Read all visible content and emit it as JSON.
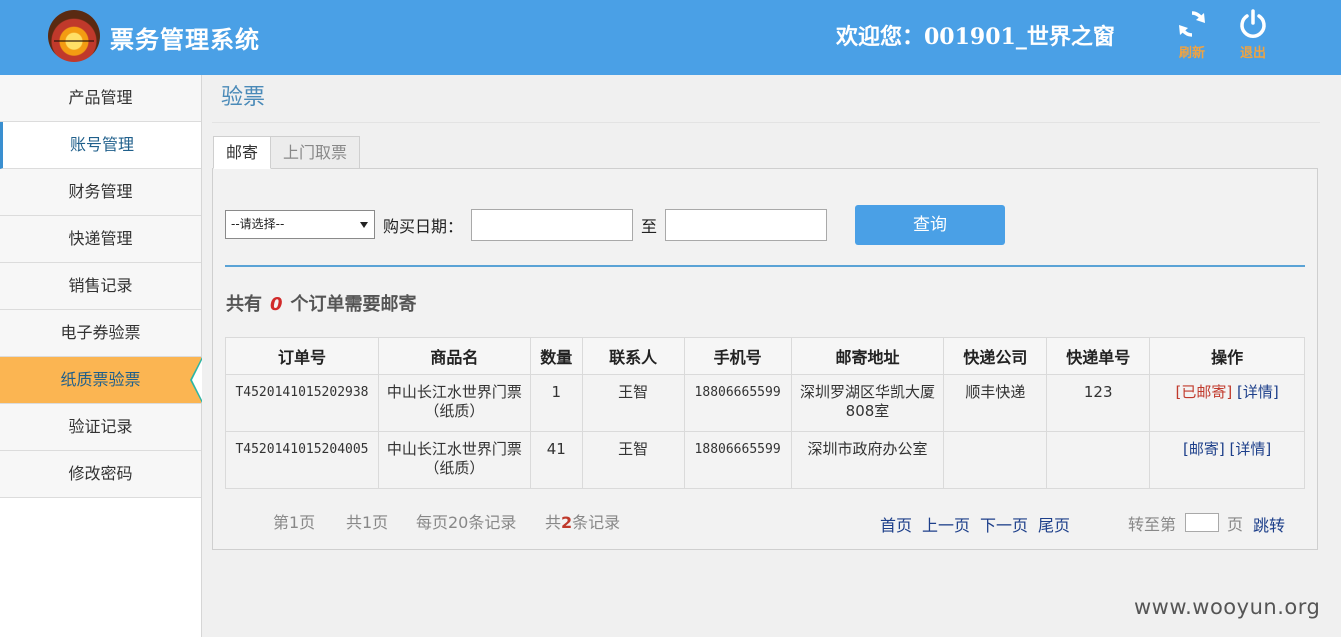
{
  "header": {
    "app_title": "票务管理系统",
    "welcome": "欢迎您：001901_世界之窗",
    "refresh_label": "刷新",
    "logout_label": "退出"
  },
  "sidebar": {
    "items": [
      {
        "label": "产品管理"
      },
      {
        "label": "账号管理"
      },
      {
        "label": "财务管理"
      },
      {
        "label": "快递管理"
      },
      {
        "label": "销售记录"
      },
      {
        "label": "电子券验票"
      },
      {
        "label": "纸质票验票"
      },
      {
        "label": "验证记录"
      },
      {
        "label": "修改密码"
      }
    ],
    "active_index": 6
  },
  "main": {
    "page_title": "验票",
    "tabs": [
      {
        "label": "邮寄"
      },
      {
        "label": "上门取票"
      }
    ],
    "filter": {
      "select_value": "--请选择--",
      "date_label": "购买日期：",
      "to_label": "至",
      "query_label": "查询"
    },
    "summary": {
      "prefix": "共有",
      "count": "0",
      "suffix": "个订单需要邮寄"
    },
    "table": {
      "headers": [
        "订单号",
        "商品名",
        "数量",
        "联系人",
        "手机号",
        "邮寄地址",
        "快递公司",
        "快递单号",
        "操作"
      ],
      "rows": [
        {
          "order_no": "T4520141015202938",
          "product": "中山长江水世界门票（纸质）",
          "qty": "1",
          "contact": "王智",
          "phone": "18806665599",
          "address": "深圳罗湖区华凯大厦808室",
          "courier": "顺丰快递",
          "tracking": "123",
          "action1": "[已邮寄]",
          "action2": "[详情]"
        },
        {
          "order_no": "T4520141015204005",
          "product": "中山长江水世界门票（纸质）",
          "qty": "41",
          "contact": "王智",
          "phone": "18806665599",
          "address": "深圳市政府办公室",
          "courier": "",
          "tracking": "",
          "action1": "[邮寄]",
          "action2": "[详情]"
        }
      ]
    },
    "pager": {
      "page": "第1页",
      "total_pages": "共1页",
      "per_page": "每页20条记录",
      "total_prefix": "共",
      "total_count": "2",
      "total_suffix": "条记录",
      "first": "首页",
      "prev": "上一页",
      "next": "下一页",
      "last": "尾页",
      "goto_prefix": "转至第",
      "goto_suffix": "页",
      "goto_button": "跳转"
    }
  },
  "watermark": "www.wooyun.org",
  "colors": {
    "header_bg": "#4aa0e6",
    "active_nav": "#fbb552",
    "accent_red": "#c0392b",
    "link_blue": "#1d3f8a"
  }
}
